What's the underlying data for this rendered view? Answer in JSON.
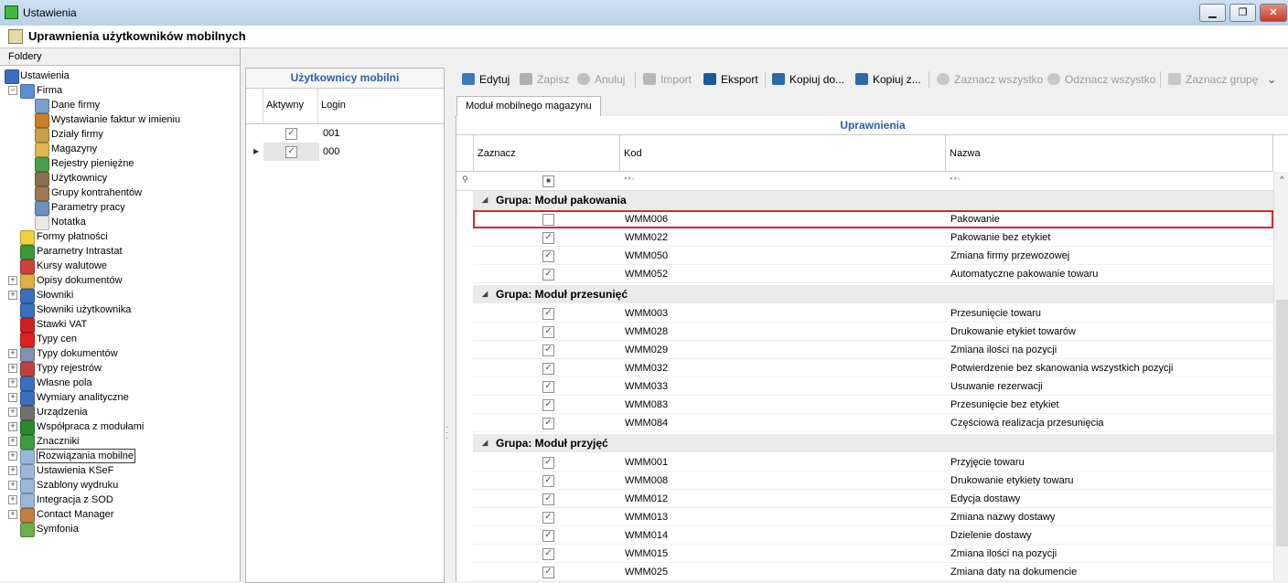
{
  "window": {
    "title": "Ustawienia",
    "min": "▁",
    "max": "❐",
    "close": "✕"
  },
  "module_title": "Uprawnienia użytkowników mobilnych",
  "folders": {
    "title": "Foldery",
    "items": [
      {
        "label": "Ustawienia",
        "color": "#3a6fc0"
      },
      {
        "label": "Firma",
        "color": "#5b8fd0"
      },
      {
        "label": "Dane firmy",
        "color": "#7aa0cc"
      },
      {
        "label": "Wystawianie faktur w imieniu",
        "color": "#d07a2e"
      },
      {
        "label": "Działy firmy",
        "color": "#c9a04a"
      },
      {
        "label": "Magazyny",
        "color": "#e0b850"
      },
      {
        "label": "Rejestry pieniężne",
        "color": "#4aa04a"
      },
      {
        "label": "Użytkownicy",
        "color": "#8a7050"
      },
      {
        "label": "Grupy kontrahentów",
        "color": "#a07850"
      },
      {
        "label": "Parametry pracy",
        "color": "#6a8fc0"
      },
      {
        "label": "Notatka",
        "color": "#e8e8e8"
      },
      {
        "label": "Formy płatności",
        "color": "#f0d040"
      },
      {
        "label": "Parametry Intrastat",
        "color": "#3a9a3a"
      },
      {
        "label": "Kursy walutowe",
        "color": "#d04040"
      },
      {
        "label": "Opisy dokumentów",
        "color": "#e0b040"
      },
      {
        "label": "Słowniki",
        "color": "#3a6fc0"
      },
      {
        "label": "Słowniki użytkownika",
        "color": "#3a6fc0"
      },
      {
        "label": "Stawki VAT",
        "color": "#d02020"
      },
      {
        "label": "Typy cen",
        "color": "#e02020"
      },
      {
        "label": "Typy dokumentów",
        "color": "#8090b0"
      },
      {
        "label": "Typy rejestrów",
        "color": "#c04040"
      },
      {
        "label": "Własne pola",
        "color": "#3a6fc0"
      },
      {
        "label": "Wymiary analityczne",
        "color": "#3a6fc0"
      },
      {
        "label": "Urządzenia",
        "color": "#707070"
      },
      {
        "label": "Współpraca z modułami",
        "color": "#2a8a2a"
      },
      {
        "label": "Znaczniki",
        "color": "#3aa03a"
      },
      {
        "label": "Rozwiązania mobilne",
        "color": "#9ab8dc"
      },
      {
        "label": "Ustawienia KSeF",
        "color": "#9ab8dc"
      },
      {
        "label": "Szablony wydruku",
        "color": "#9ab8dc"
      },
      {
        "label": "Integracja z SOD",
        "color": "#9ab8dc"
      },
      {
        "label": "Contact Manager",
        "color": "#c08040"
      },
      {
        "label": "Symfonia",
        "color": "#6ab04a"
      }
    ]
  },
  "users_panel": {
    "title": "Użytkownicy mobilni",
    "columns": [
      "Aktywny",
      "Login"
    ],
    "rows": [
      {
        "active": true,
        "login": "001"
      },
      {
        "active": true,
        "login": "000"
      }
    ]
  },
  "toolbar": {
    "edit": "Edytuj",
    "save": "Zapisz",
    "cancel": "Anuluj",
    "import": "Import",
    "export": "Eksport",
    "copy_to": "Kopiuj do...",
    "copy_from": "Kopiuj z...",
    "select_all": "Zaznacz wszystko",
    "deselect_all": "Odznacz wszystko",
    "select_group": "Zaznacz grupę",
    "more": "⌄"
  },
  "tab": "Moduł mobilnego magazynu",
  "grid": {
    "title": "Uprawnienia",
    "columns": {
      "check": "Zaznacz",
      "code": "Kod",
      "name": "Nazwa"
    },
    "filter_hint": "ᴿᴮᶜ",
    "groups": [
      {
        "title": "Grupa: Moduł pakowania",
        "rows": [
          {
            "checked": false,
            "code": "WMM006",
            "name": "Pakowanie"
          },
          {
            "checked": true,
            "code": "WMM022",
            "name": "Pakowanie bez etykiet"
          },
          {
            "checked": true,
            "code": "WMM050",
            "name": "Zmiana firmy przewozowej"
          },
          {
            "checked": true,
            "code": "WMM052",
            "name": "Automatyczne pakowanie towaru"
          }
        ]
      },
      {
        "title": "Grupa: Moduł przesunięć",
        "rows": [
          {
            "checked": true,
            "code": "WMM003",
            "name": "Przesunięcie towaru"
          },
          {
            "checked": true,
            "code": "WMM028",
            "name": "Drukowanie etykiet towarów"
          },
          {
            "checked": true,
            "code": "WMM029",
            "name": "Zmiana ilości na pozycji"
          },
          {
            "checked": true,
            "code": "WMM032",
            "name": "Potwierdzenie bez skanowania wszystkich pozycji"
          },
          {
            "checked": true,
            "code": "WMM033",
            "name": "Usuwanie rezerwacji"
          },
          {
            "checked": true,
            "code": "WMM083",
            "name": "Przesunięcie bez etykiet"
          },
          {
            "checked": true,
            "code": "WMM084",
            "name": "Częściowa realizacja przesunięcia"
          }
        ]
      },
      {
        "title": "Grupa: Moduł przyjęć",
        "rows": [
          {
            "checked": true,
            "code": "WMM001",
            "name": "Przyjęcie towaru"
          },
          {
            "checked": true,
            "code": "WMM008",
            "name": "Drukowanie etykiety towaru"
          },
          {
            "checked": true,
            "code": "WMM012",
            "name": "Edycja dostawy"
          },
          {
            "checked": true,
            "code": "WMM013",
            "name": "Zmiana nazwy dostawy"
          },
          {
            "checked": true,
            "code": "WMM014",
            "name": "Dzielenie dostawy"
          },
          {
            "checked": true,
            "code": "WMM015",
            "name": "Zmiana ilości na pozycji"
          },
          {
            "checked": true,
            "code": "WMM025",
            "name": "Zmiana daty na dokumencie"
          }
        ]
      }
    ]
  }
}
